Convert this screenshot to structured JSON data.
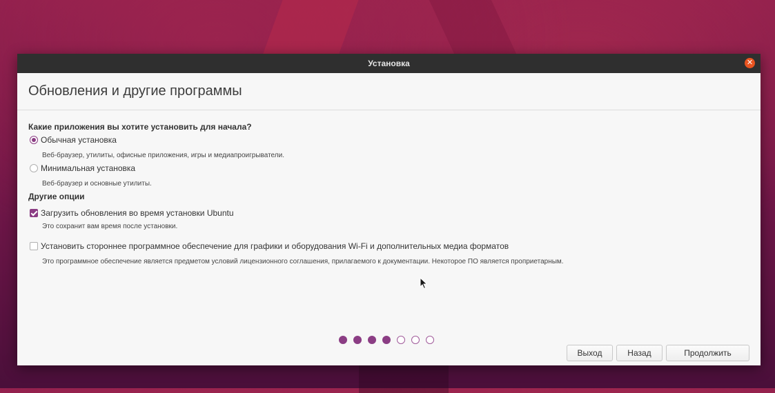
{
  "window": {
    "title": "Установка"
  },
  "page": {
    "title": "Обновления и другие программы"
  },
  "install_type": {
    "question": "Какие приложения вы хотите установить для начала?",
    "options": [
      {
        "label": "Обычная установка",
        "hint": "Веб-браузер, утилиты, офисные приложения, игры и медиапроигрыватели.",
        "selected": true
      },
      {
        "label": "Минимальная установка",
        "hint": "Веб-браузер и основные утилиты.",
        "selected": false
      }
    ]
  },
  "other_options": {
    "title": "Другие опции",
    "items": [
      {
        "label": "Загрузить обновления во время установки Ubuntu",
        "hint": "Это сохранит вам время после установки.",
        "checked": true
      },
      {
        "label": "Установить стороннее программное обеспечение для графики и оборудования Wi-Fi и дополнительных медиа форматов",
        "hint": "Это программное обеспечение является предметом условий лицензионного соглашения, прилагаемого к документации. Некоторое ПО является проприетарным.",
        "checked": false
      }
    ]
  },
  "buttons": {
    "quit": "Выход",
    "back": "Назад",
    "continue": "Продолжить"
  },
  "progress": {
    "total_steps": 7,
    "completed_steps": 4
  },
  "colors": {
    "accent": "#8b3d84",
    "titlebar": "#2f2f2f",
    "close": "#e95420"
  }
}
